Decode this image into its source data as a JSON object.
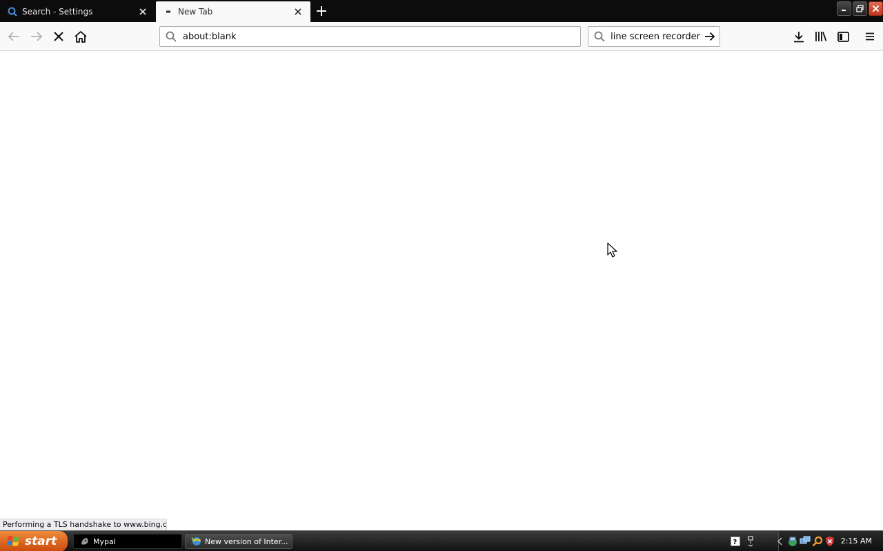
{
  "browser": {
    "tabs": [
      {
        "label": "Search - Settings",
        "favicon": "search-favicon-icon",
        "active": false
      },
      {
        "label": "New Tab",
        "favicon": "loading-dash-icon",
        "active": true
      }
    ],
    "address_bar": {
      "value": "about:blank"
    },
    "search_bar": {
      "value": "online screen recorder"
    },
    "status_text": "Performing a TLS handshake to www.bing.com..."
  },
  "taskbar": {
    "start_label": "start",
    "tasks": [
      {
        "label": "Mypal",
        "icon": "mypal-app-icon"
      },
      {
        "label": "New version of Inter...",
        "icon": "ie-update-icon"
      }
    ],
    "clock": "2:15 AM"
  },
  "colors": {
    "tabstrip_bg": "#0c0c0d",
    "toolbar_bg": "#f9f9fa",
    "start_orange": "#e0701f",
    "close_red": "#c23620"
  }
}
